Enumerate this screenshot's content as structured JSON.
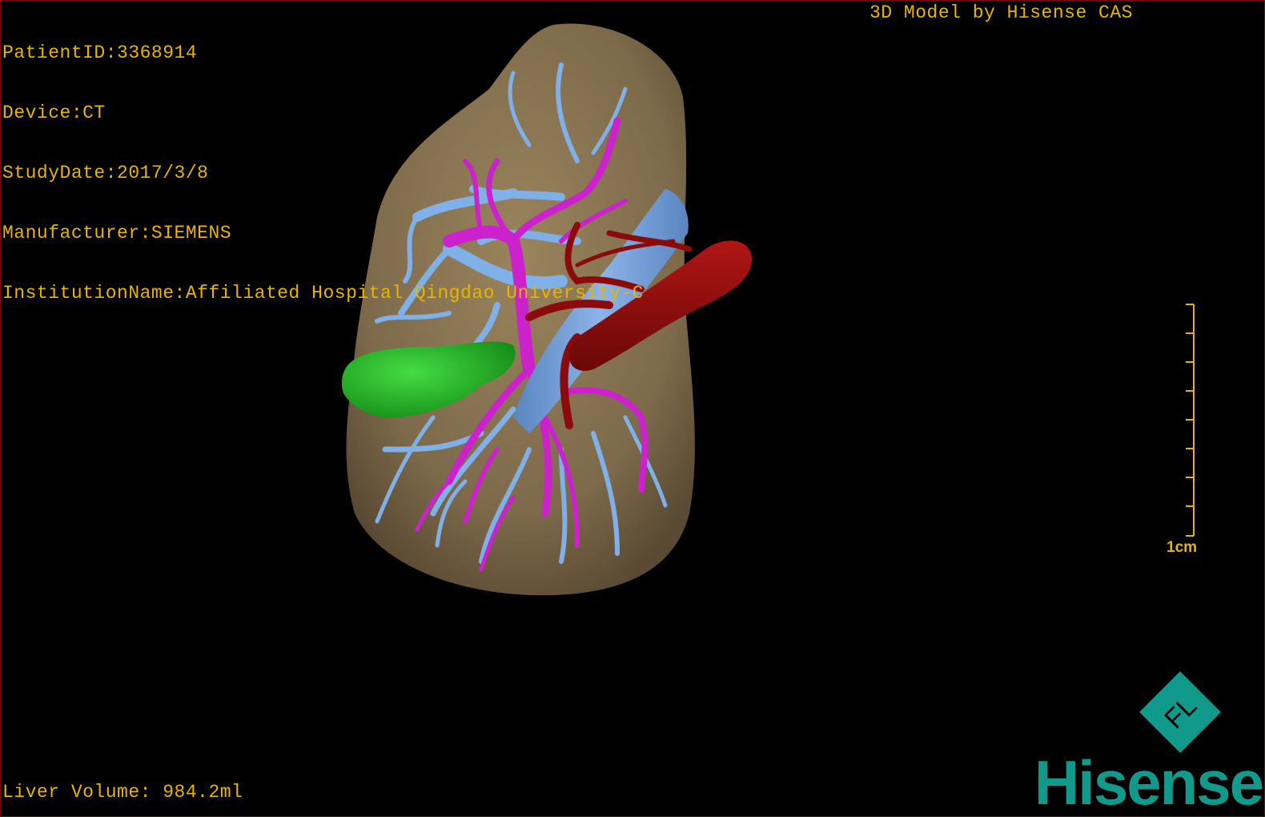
{
  "header": {
    "patient_id": "PatientID:3368914",
    "device": "Device:CT",
    "study_date": "StudyDate:2017/3/8",
    "manufacturer": "Manufacturer:SIEMENS",
    "institution": "InstitutionName:Affiliated Hospital Qingdao University-C",
    "credit": "3D Model by Hisense CAS"
  },
  "footer": {
    "liver_volume": "Liver Volume: 984.2ml"
  },
  "scale": {
    "label": "1cm"
  },
  "logo": {
    "word": "Hisense",
    "emblem_text": "FL",
    "color": "#119a8c"
  },
  "colors": {
    "overlay_text": "#e8b400",
    "liver": "#7d6a4b",
    "portal_vein": "#7fb0e8",
    "hepatic_vein": "#cc22cc",
    "artery": "#8b0a0a",
    "gallbladder": "#22aa22"
  }
}
